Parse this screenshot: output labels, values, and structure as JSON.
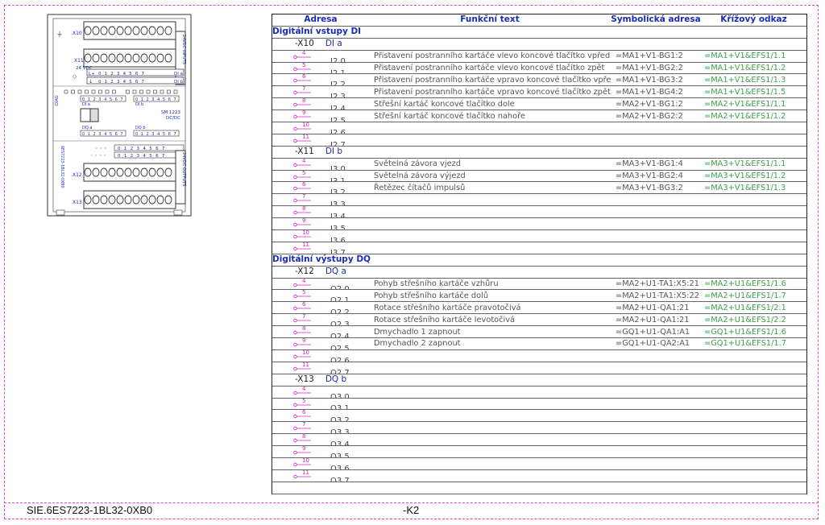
{
  "module": {
    "labels": {
      "x10": "X10",
      "x11": "X11",
      "x12": "X12",
      "x13": "X13",
      "vdc24": "24 VDC",
      "l_plus": "L+",
      "m": "M",
      "di_a": "DI a",
      "di_b": "DI b",
      "dq_a": "DQ a",
      "dq_b": "DQ b",
      "diag": "DIAG",
      "sm": "SM 1223",
      "dcdc": "DC/DC",
      "inputs": "24VDC INPUTS",
      "outputs": "24VDC OUTPUTS",
      "part": "6ES7223-1BL32-0XB0",
      "digits": "0 1 2 3 4 5 6 7"
    }
  },
  "table": {
    "headers": {
      "adresa": "Adresa",
      "funkcni_text": "Funkční text",
      "symbolicka_adresa": "Symbolická adresa",
      "krizovy_odkaz": "Křížový odkaz"
    },
    "rows": [
      {
        "kind": "section",
        "label": "Digitální vstupy DI"
      },
      {
        "kind": "group",
        "conn": "-X10",
        "name": "DI a"
      },
      {
        "kind": "io",
        "pin": "4",
        "addr": "I2.0",
        "text": "Přistavení postranního kartáče vlevo koncové tlačítko vpřed",
        "sym": "=MA1+V1-BG1:2",
        "xref": "=MA1+V1&EFS1/1.1"
      },
      {
        "kind": "io",
        "pin": "5",
        "addr": "I2.1",
        "text": "Přistavení postranního kartáče vlevo koncové tlačítko zpět",
        "sym": "=MA1+V1-BG2:2",
        "xref": "=MA1+V1&EFS1/1.2"
      },
      {
        "kind": "io",
        "pin": "6",
        "addr": "I2.2",
        "text": "Přistavení postranního kartáče vpravo koncové tlačítko vpřed",
        "sym": "=MA1+V1-BG3:2",
        "xref": "=MA1+V1&EFS1/1.3"
      },
      {
        "kind": "io",
        "pin": "7",
        "addr": "I2.3",
        "text": "Přistavení postranního kartáče vpravo koncové tlačítko zpět",
        "sym": "=MA1+V1-BG4:2",
        "xref": "=MA1+V1&EFS1/1.5"
      },
      {
        "kind": "io",
        "pin": "8",
        "addr": "I2.4",
        "text": "Střešní kartáč koncové tlačítko dole",
        "sym": "=MA2+V1-BG1:2",
        "xref": "=MA2+V1&EFS1/1.1"
      },
      {
        "kind": "io",
        "pin": "9",
        "addr": "I2.5",
        "text": "Střešní kartáč koncové tlačítko nahoře",
        "sym": "=MA2+V1-BG2:2",
        "xref": "=MA2+V1&EFS1/1.2"
      },
      {
        "kind": "io",
        "pin": "10",
        "addr": "I2.6",
        "text": "",
        "sym": "",
        "xref": ""
      },
      {
        "kind": "io",
        "pin": "11",
        "addr": "I2.7",
        "text": "",
        "sym": "",
        "xref": ""
      },
      {
        "kind": "group",
        "conn": "-X11",
        "name": "DI b"
      },
      {
        "kind": "io",
        "pin": "4",
        "addr": "I3.0",
        "text": "Světelná závora vjezd",
        "sym": "=MA3+V1-BG1:4",
        "xref": "=MA3+V1&EFS1/1.1"
      },
      {
        "kind": "io",
        "pin": "5",
        "addr": "I3.1",
        "text": "Světelná závora výjezd",
        "sym": "=MA3+V1-BG2:4",
        "xref": "=MA3+V1&EFS1/1.2"
      },
      {
        "kind": "io",
        "pin": "6",
        "addr": "I3.2",
        "text": "Řetězec čítačů impulsů",
        "sym": "=MA3+V1-BG3:2",
        "xref": "=MA3+V1&EFS1/1.3"
      },
      {
        "kind": "io",
        "pin": "7",
        "addr": "I3.3",
        "text": "",
        "sym": "",
        "xref": ""
      },
      {
        "kind": "io",
        "pin": "8",
        "addr": "I3.4",
        "text": "",
        "sym": "",
        "xref": ""
      },
      {
        "kind": "io",
        "pin": "9",
        "addr": "I3.5",
        "text": "",
        "sym": "",
        "xref": ""
      },
      {
        "kind": "io",
        "pin": "10",
        "addr": "I3.6",
        "text": "",
        "sym": "",
        "xref": ""
      },
      {
        "kind": "io",
        "pin": "11",
        "addr": "I3.7",
        "text": "",
        "sym": "",
        "xref": ""
      },
      {
        "kind": "section",
        "label": "Digitální výstupy DQ"
      },
      {
        "kind": "group",
        "conn": "-X12",
        "name": "DQ a"
      },
      {
        "kind": "io",
        "pin": "4",
        "addr": "Q2.0",
        "text": "Pohyb střešního kartáče vzhůru",
        "sym": "=MA2+U1-TA1:X5:21",
        "xref": "=MA2+U1&EFS1/1.6"
      },
      {
        "kind": "io",
        "pin": "5",
        "addr": "Q2.1",
        "text": "Pohyb střešního kartáče dolů",
        "sym": "=MA2+U1-TA1:X5:22",
        "xref": "=MA2+U1&EFS1/1.7"
      },
      {
        "kind": "io",
        "pin": "6",
        "addr": "Q2.2",
        "text": "Rotace střešního kartáče pravotočivá",
        "sym": "=MA2+U1-QA1:21",
        "xref": "=MA2+U1&EFS1/2.1"
      },
      {
        "kind": "io",
        "pin": "7",
        "addr": "Q2.3",
        "text": "Rotace střešního kartáče levotočivá",
        "sym": "=MA2+U1-QA1:21",
        "xref": "=MA2+U1&EFS1/2.2"
      },
      {
        "kind": "io",
        "pin": "8",
        "addr": "Q2.4",
        "text": "Dmychadlo 1 zapnout",
        "sym": "=GQ1+U1-QA1:A1",
        "xref": "=GQ1+U1&EFS1/1.6"
      },
      {
        "kind": "io",
        "pin": "9",
        "addr": "Q2.5",
        "text": "Dmychadlo 2 zapnout",
        "sym": "=GQ1+U1-QA2:A1",
        "xref": "=GQ1+U1&EFS1/1.7"
      },
      {
        "kind": "io",
        "pin": "10",
        "addr": "Q2.6",
        "text": "",
        "sym": "",
        "xref": ""
      },
      {
        "kind": "io",
        "pin": "11",
        "addr": "Q2.7",
        "text": "",
        "sym": "",
        "xref": ""
      },
      {
        "kind": "group",
        "conn": "-X13",
        "name": "DQ b"
      },
      {
        "kind": "io",
        "pin": "4",
        "addr": "Q3.0",
        "text": "",
        "sym": "",
        "xref": ""
      },
      {
        "kind": "io",
        "pin": "5",
        "addr": "Q3.1",
        "text": "",
        "sym": "",
        "xref": ""
      },
      {
        "kind": "io",
        "pin": "6",
        "addr": "Q3.2",
        "text": "",
        "sym": "",
        "xref": ""
      },
      {
        "kind": "io",
        "pin": "7",
        "addr": "Q3.3",
        "text": "",
        "sym": "",
        "xref": ""
      },
      {
        "kind": "io",
        "pin": "8",
        "addr": "Q3.4",
        "text": "",
        "sym": "",
        "xref": ""
      },
      {
        "kind": "io",
        "pin": "9",
        "addr": "Q3.5",
        "text": "",
        "sym": "",
        "xref": ""
      },
      {
        "kind": "io",
        "pin": "10",
        "addr": "Q3.6",
        "text": "",
        "sym": "",
        "xref": ""
      },
      {
        "kind": "io",
        "pin": "11",
        "addr": "Q3.7",
        "text": "",
        "sym": "",
        "xref": ""
      }
    ]
  },
  "footer": {
    "part_number": "SIE.6ES7223-1BL32-0XB0",
    "device_tag": "-K2"
  },
  "colors": {
    "frame": "#e040e0",
    "header": "#1a2bb8",
    "xref": "#3aa04a",
    "pin": "#d020c0"
  }
}
